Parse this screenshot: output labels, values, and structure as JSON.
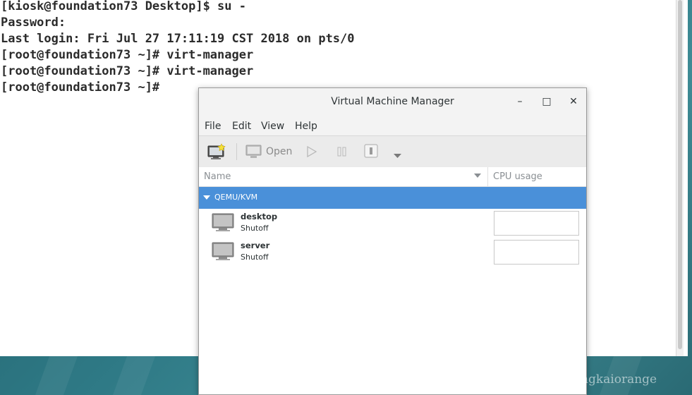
{
  "terminal": {
    "lines": [
      "[kiosk@foundation73 Desktop]$ su -",
      "Password:",
      "Last login: Fri Jul 27 17:11:19 CST 2018 on pts/0",
      "[root@foundation73 ~]# virt-manager",
      "[root@foundation73 ~]# virt-manager",
      "[root@foundation73 ~]#"
    ]
  },
  "window": {
    "title": "Virtual Machine Manager",
    "controls": {
      "minimize": "–",
      "maximize": "□",
      "close": "✕"
    }
  },
  "menu": [
    "File",
    "Edit",
    "View",
    "Help"
  ],
  "toolbar": {
    "new_vm_icon": "new-vm-icon",
    "open_label": "Open",
    "run_icon": "play-icon",
    "pause_icon": "pause-icon",
    "shutdown_icon": "power-icon",
    "menu_icon": "chevron-down-icon"
  },
  "columns": {
    "name": "Name",
    "cpu": "CPU usage"
  },
  "connection": {
    "label": "QEMU/KVM"
  },
  "vms": [
    {
      "name": "desktop",
      "state": "Shutoff"
    },
    {
      "name": "server",
      "state": "Shutoff"
    }
  ],
  "watermark": "https://blog.csdn.net/yangkaiorange",
  "colors": {
    "selection": "#4a90d9",
    "desktop": "#2f6f7a"
  }
}
